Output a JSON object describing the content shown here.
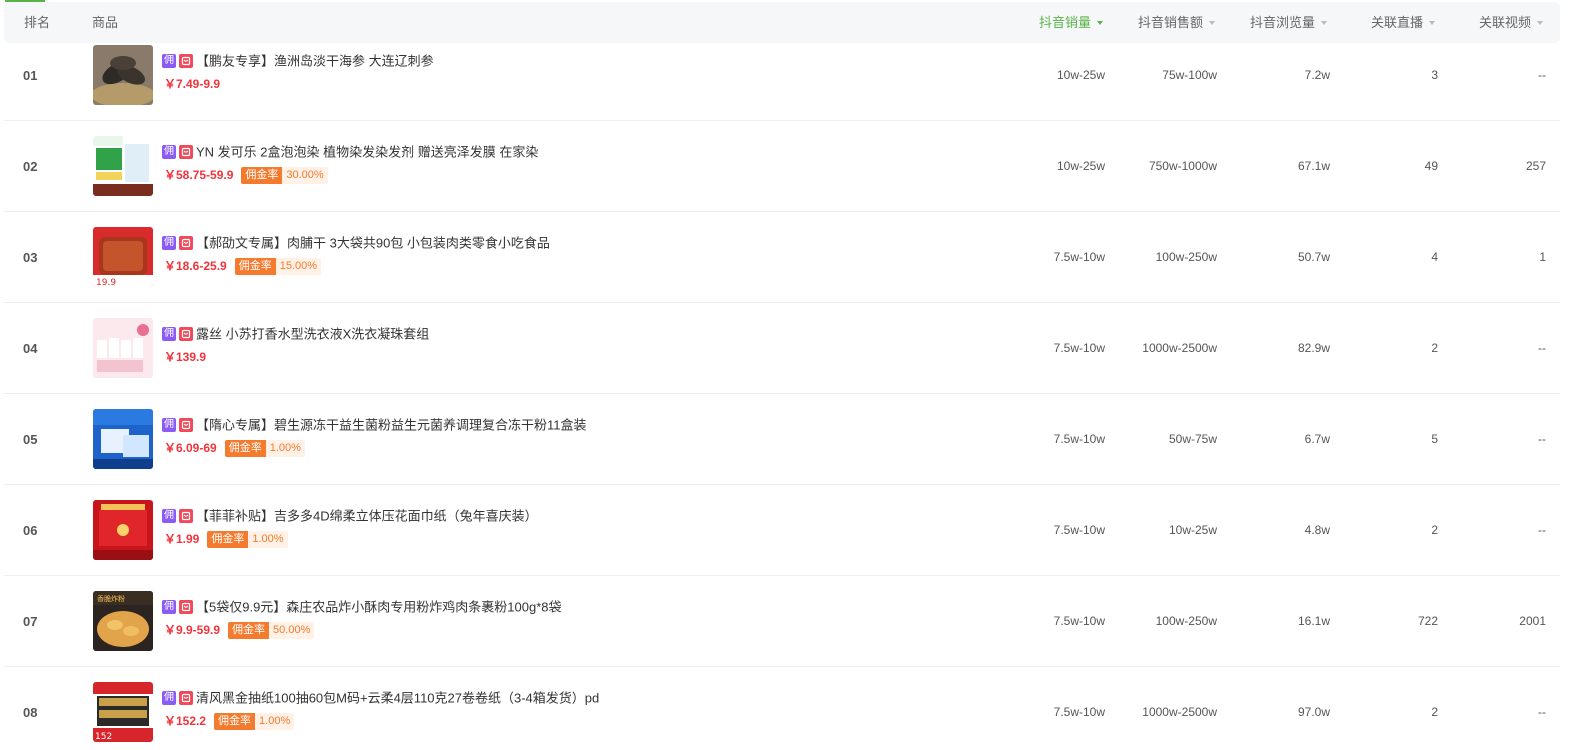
{
  "header": {
    "rank": "排名",
    "product": "商品",
    "sales": "抖音销量",
    "revenue": "抖音销售额",
    "views": "抖音浏览量",
    "live": "关联直播",
    "video": "关联视频"
  },
  "colors": {
    "accent": "#59b34a",
    "price": "#f0343c",
    "rate": "#f47a2e",
    "tag_yong": "#8a5cf5",
    "tag_shop": "#f04a5a"
  },
  "tags": {
    "commission": "佣",
    "rate_label": "佣金率"
  },
  "rows": [
    {
      "rank": "01",
      "title": "【鹏友专享】渔洲岛淡干海参 大连辽刺参",
      "price": "￥7.49-9.9",
      "rate": "",
      "sales": "10w-25w",
      "revenue": "75w-100w",
      "views": "7.2w",
      "live": "3",
      "video": "--"
    },
    {
      "rank": "02",
      "title": "YN 发可乐 2盒泡泡染 植物染发染发剂 赠送亮泽发膜 在家染",
      "price": "￥58.75-59.9",
      "rate": "30.00%",
      "sales": "10w-25w",
      "revenue": "750w-1000w",
      "views": "67.1w",
      "live": "49",
      "video": "257"
    },
    {
      "rank": "03",
      "title": "【郝劭文专属】肉脯干 3大袋共90包 小包装肉类零食小吃食品",
      "price": "￥18.6-25.9",
      "rate": "15.00%",
      "sales": "7.5w-10w",
      "revenue": "100w-250w",
      "views": "50.7w",
      "live": "4",
      "video": "1"
    },
    {
      "rank": "04",
      "title": "露丝 小苏打香水型洗衣液X洗衣凝珠套组",
      "price": "￥139.9",
      "rate": "",
      "sales": "7.5w-10w",
      "revenue": "1000w-2500w",
      "views": "82.9w",
      "live": "2",
      "video": "--"
    },
    {
      "rank": "05",
      "title": "【隋心专属】碧生源冻干益生菌粉益生元菌养调理复合冻干粉11盒装",
      "price": "￥6.09-69",
      "rate": "1.00%",
      "sales": "7.5w-10w",
      "revenue": "50w-75w",
      "views": "6.7w",
      "live": "5",
      "video": "--"
    },
    {
      "rank": "06",
      "title": "【菲菲补贴】吉多多4D绵柔立体压花面巾纸（兔年喜庆装）",
      "price": "￥1.99",
      "rate": "1.00%",
      "sales": "7.5w-10w",
      "revenue": "10w-25w",
      "views": "4.8w",
      "live": "2",
      "video": "--"
    },
    {
      "rank": "07",
      "title": "【5袋仅9.9元】森庄农品炸小酥肉专用粉炸鸡肉条裹粉100g*8袋",
      "price": "￥9.9-59.9",
      "rate": "50.00%",
      "sales": "7.5w-10w",
      "revenue": "100w-250w",
      "views": "16.1w",
      "live": "722",
      "video": "2001"
    },
    {
      "rank": "08",
      "title": "清风黑金抽纸100抽60包M码+云柔4层110克27卷卷纸（3-4箱发货）pd",
      "price": "￥152.2",
      "rate": "1.00%",
      "sales": "7.5w-10w",
      "revenue": "1000w-2500w",
      "views": "97.0w",
      "live": "2",
      "video": "--"
    }
  ]
}
